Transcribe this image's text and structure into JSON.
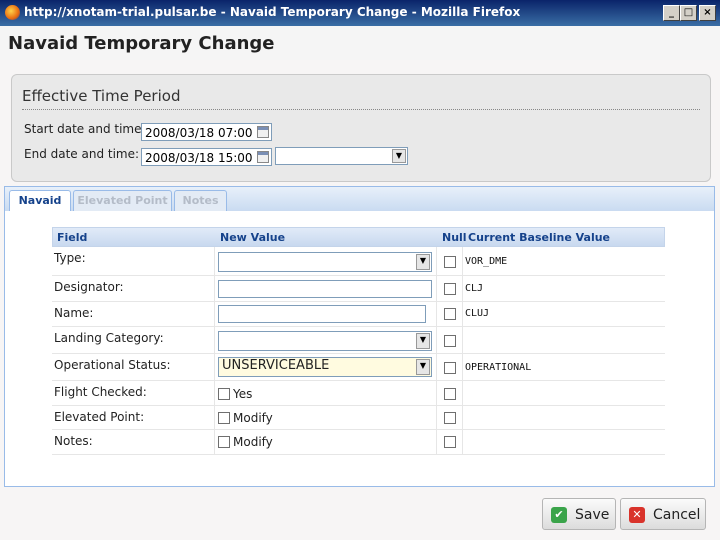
{
  "window": {
    "title": "http://xnotam-trial.pulsar.be - Navaid Temporary Change - Mozilla Firefox",
    "min_glyph": "_",
    "max_glyph": "□",
    "close_glyph": "×"
  },
  "dialog": {
    "title": "Navaid Temporary Change"
  },
  "period": {
    "legend": "Effective Time Period",
    "start_label": "Start date and time:",
    "start_value": "2008/03/18 07:00",
    "end_label": "End date and time:",
    "end_value": "2008/03/18 15:00",
    "end_qualifier": ""
  },
  "tabs": [
    {
      "label": "Navaid",
      "active": true
    },
    {
      "label": "Elevated Point",
      "active": false
    },
    {
      "label": "Notes",
      "active": false
    }
  ],
  "grid": {
    "headers": {
      "field": "Field",
      "new_value": "New Value",
      "null": "Null",
      "baseline": "Current Baseline Value"
    },
    "rows": [
      {
        "field": "Type:",
        "new_value": "",
        "baseline": "VOR_DME"
      },
      {
        "field": "Designator:",
        "new_value": "",
        "baseline": "CLJ"
      },
      {
        "field": "Name:",
        "new_value": "",
        "baseline": "CLUJ"
      },
      {
        "field": "Landing Category:",
        "new_value": "",
        "baseline": ""
      },
      {
        "field": "Operational Status:",
        "new_value": "UNSERVICEABLE",
        "baseline": "OPERATIONAL"
      },
      {
        "field": "Flight Checked:",
        "checkbox_label": "Yes",
        "baseline": ""
      },
      {
        "field": "Elevated Point:",
        "checkbox_label": "Modify",
        "baseline": ""
      },
      {
        "field": "Notes:",
        "checkbox_label": "Modify",
        "baseline": ""
      }
    ]
  },
  "footer": {
    "save_label": "Save",
    "cancel_label": "Cancel",
    "save_color": "#3aa44a",
    "cancel_color": "#d9332b"
  }
}
